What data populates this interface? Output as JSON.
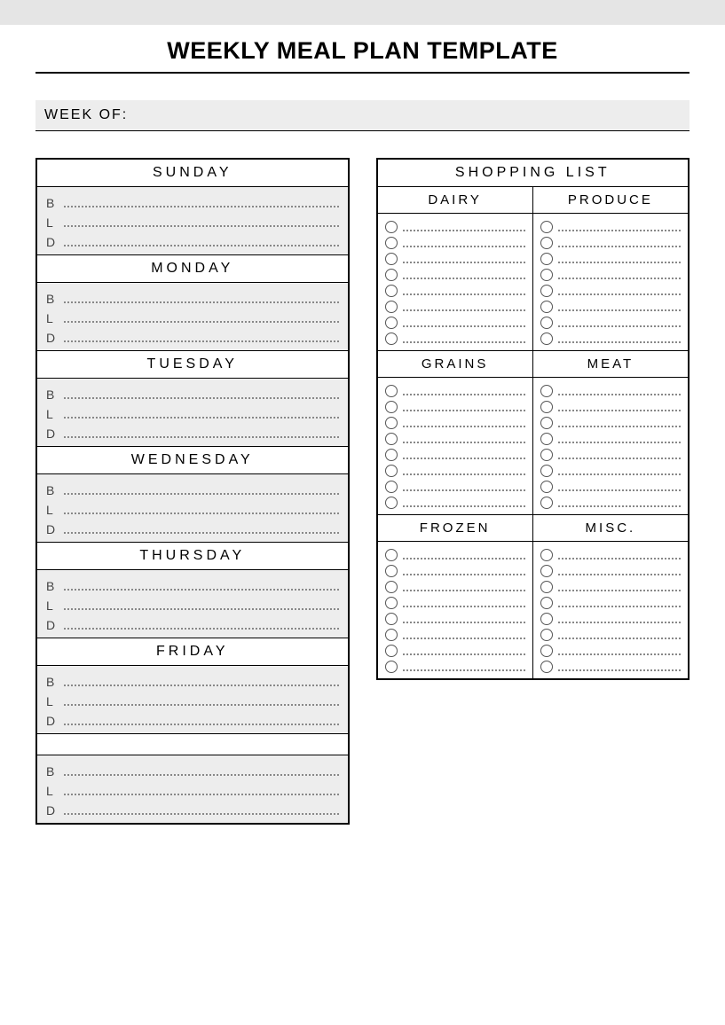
{
  "title": "WEEKLY MEAL PLAN TEMPLATE",
  "week_of_label": "WEEK OF:",
  "meals": {
    "b": "B",
    "l": "L",
    "d": "D"
  },
  "days": [
    {
      "name": "SUNDAY"
    },
    {
      "name": "MONDAY"
    },
    {
      "name": "TUESDAY"
    },
    {
      "name": "WEDNESDAY"
    },
    {
      "name": "THURSDAY"
    },
    {
      "name": "FRIDAY"
    },
    {
      "name": ""
    }
  ],
  "shopping": {
    "title": "SHOPPING LIST",
    "rows": [
      {
        "left": {
          "name": "DAIRY",
          "lines": 8
        },
        "right": {
          "name": "PRODUCE",
          "lines": 8
        }
      },
      {
        "left": {
          "name": "GRAINS",
          "lines": 8
        },
        "right": {
          "name": "MEAT",
          "lines": 8
        }
      },
      {
        "left": {
          "name": "FROZEN",
          "lines": 8
        },
        "right": {
          "name": "MISC.",
          "lines": 8
        }
      }
    ]
  }
}
